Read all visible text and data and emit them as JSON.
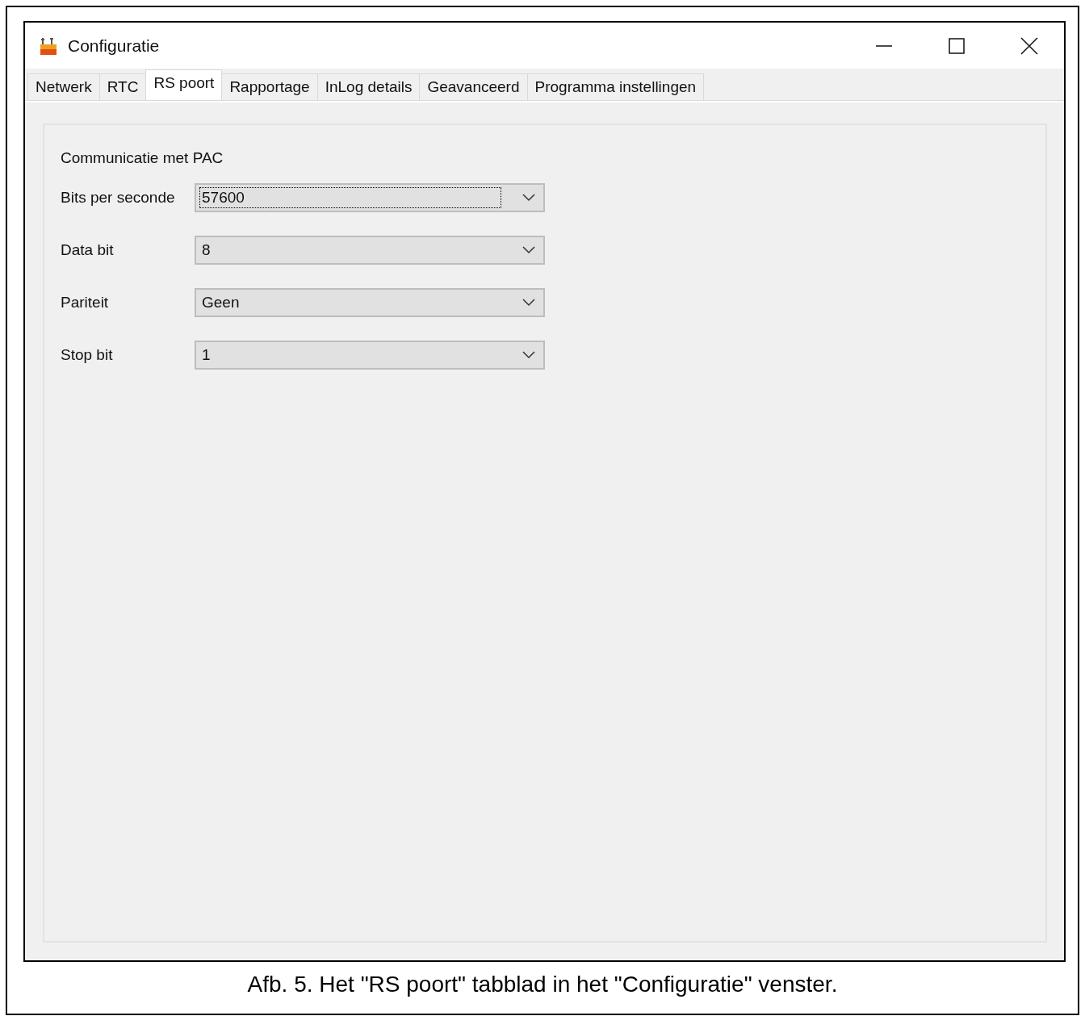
{
  "window": {
    "title": "Configuratie"
  },
  "tabs": [
    {
      "label": "Netwerk",
      "selected": false
    },
    {
      "label": "RTC",
      "selected": false
    },
    {
      "label": "RS poort",
      "selected": true
    },
    {
      "label": "Rapportage",
      "selected": false
    },
    {
      "label": "InLog details",
      "selected": false
    },
    {
      "label": "Geavanceerd",
      "selected": false
    },
    {
      "label": "Programma instellingen",
      "selected": false
    }
  ],
  "panel": {
    "heading": "Communicatie met PAC",
    "fields": [
      {
        "label": "Bits per seconde",
        "value": "57600",
        "focused": true
      },
      {
        "label": "Data bit",
        "value": "8",
        "focused": false
      },
      {
        "label": "Pariteit",
        "value": "Geen",
        "focused": false
      },
      {
        "label": "Stop bit",
        "value": "1",
        "focused": false
      }
    ]
  },
  "caption": "Afb. 5. Het \"RS poort\" tabblad in het \"Configuratie\" venster."
}
